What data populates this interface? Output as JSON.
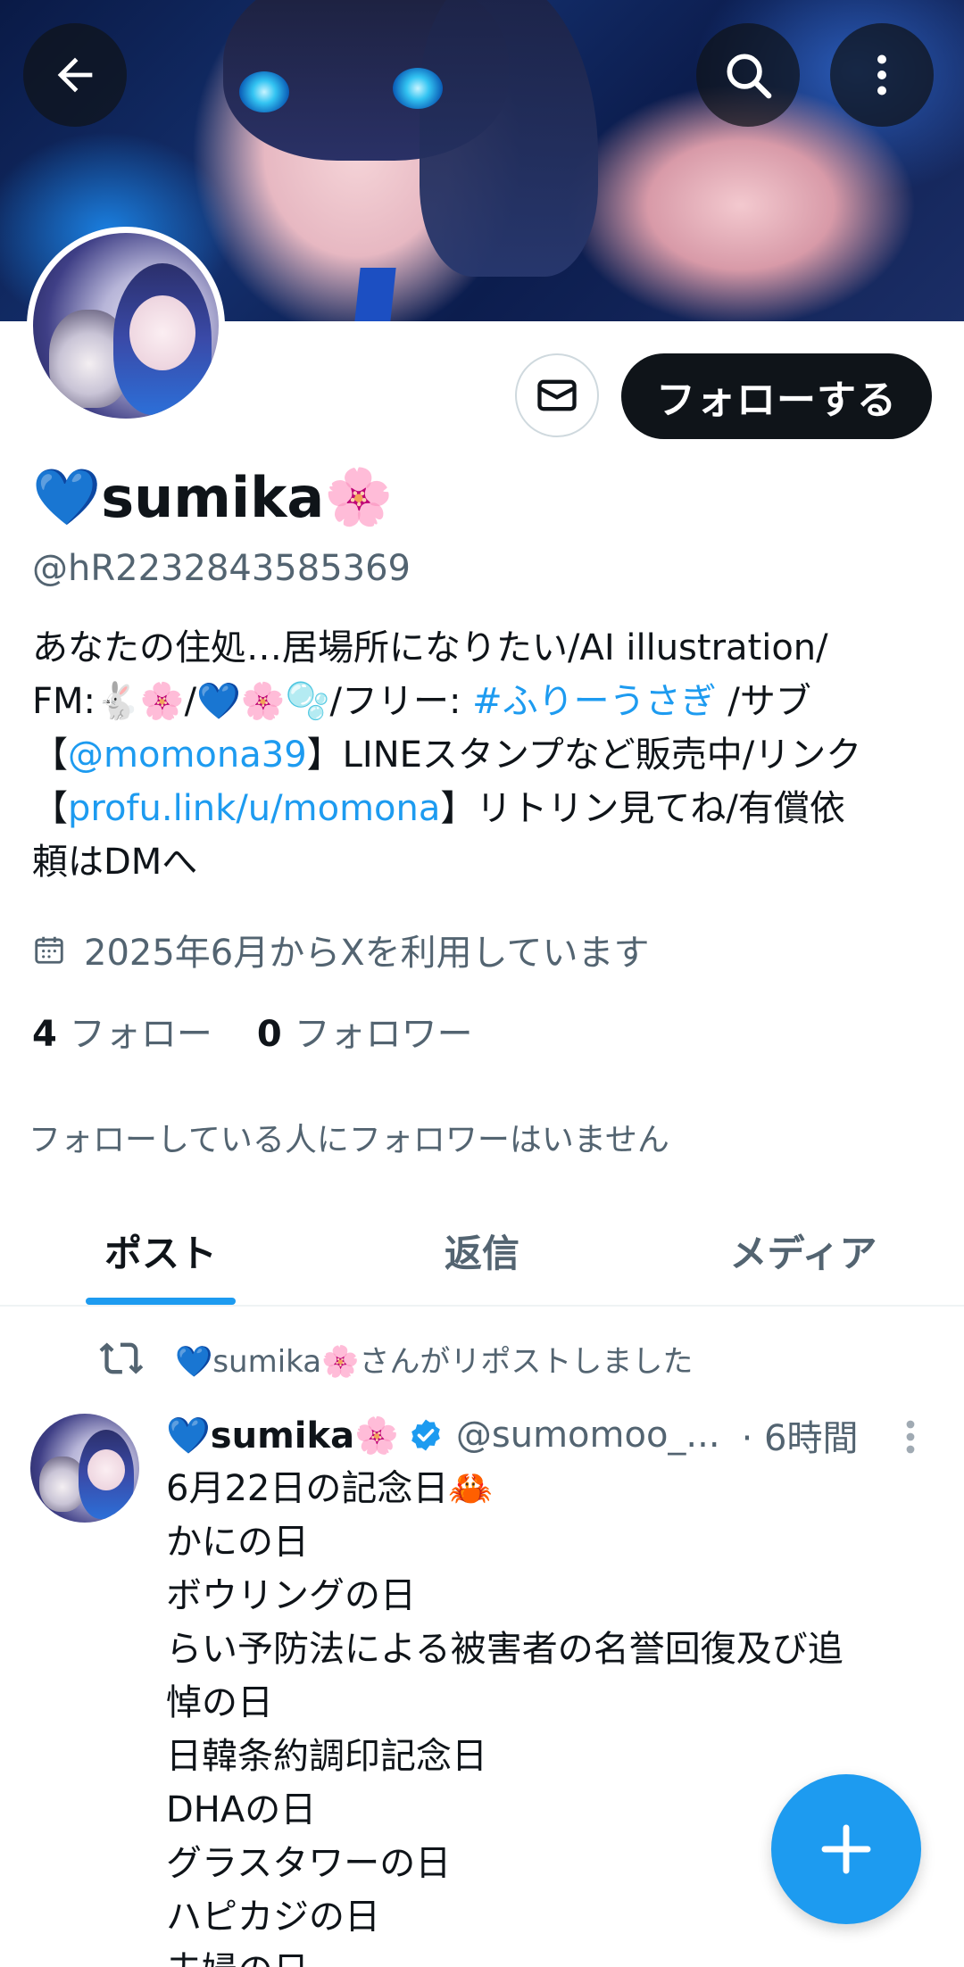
{
  "header": {
    "back_icon": "arrow-left-icon",
    "search_icon": "search-icon",
    "more_icon": "more-vertical-icon"
  },
  "profile": {
    "display_name": "sumika",
    "name_prefix_emoji": "💙",
    "name_suffix_emoji": "🌸",
    "handle": "@hR2232843585369",
    "follow_label": "フォローする",
    "message_icon": "mail-icon",
    "bio": {
      "line1": "あなたの住処…居場所になりたい/AI illustration/",
      "line2_prefix": "FM:🐇🌸/💙🌸🫧/フリー: ",
      "line2_tag": "#ふりーうさぎ",
      "line2_suffix": " /サブ",
      "line3_prefix": "【",
      "line3_mention": "@momona39",
      "line3_suffix": "】LINEスタンプなど販売中/リンク",
      "line4_prefix": "【",
      "line4_link": "profu.link/u/momona",
      "line4_suffix": "】リトリン見てね/有償依",
      "line5": "頼はDMへ"
    },
    "joined": "2025年6月からXを利用しています",
    "following_count": "4",
    "following_label": "フォロー",
    "followers_count": "0",
    "followers_label": "フォロワー",
    "no_mutual_followers": "フォローしている人にフォロワーはいません"
  },
  "tabs": [
    {
      "label": "ポスト",
      "active": true
    },
    {
      "label": "返信",
      "active": false
    },
    {
      "label": "メディア",
      "active": false
    }
  ],
  "post": {
    "repost_text": "💙sumika🌸さんがリポストしました",
    "author_name": "💙sumika🌸",
    "author_handle": "@sumomoo_...",
    "time": "· 6時間",
    "lines": [
      "6月22日の記念日🦀",
      "かにの日",
      "ボウリングの日",
      "らい予防法による被害者の名誉回復及び追",
      "悼の日",
      "日韓条約調印記念日",
      "DHAの日",
      "グラスタワーの日",
      "ハピカジの日",
      "夫婦の日"
    ]
  },
  "colors": {
    "accent": "#1d9bf0",
    "text_primary": "#0f1419",
    "text_secondary": "#536471"
  }
}
